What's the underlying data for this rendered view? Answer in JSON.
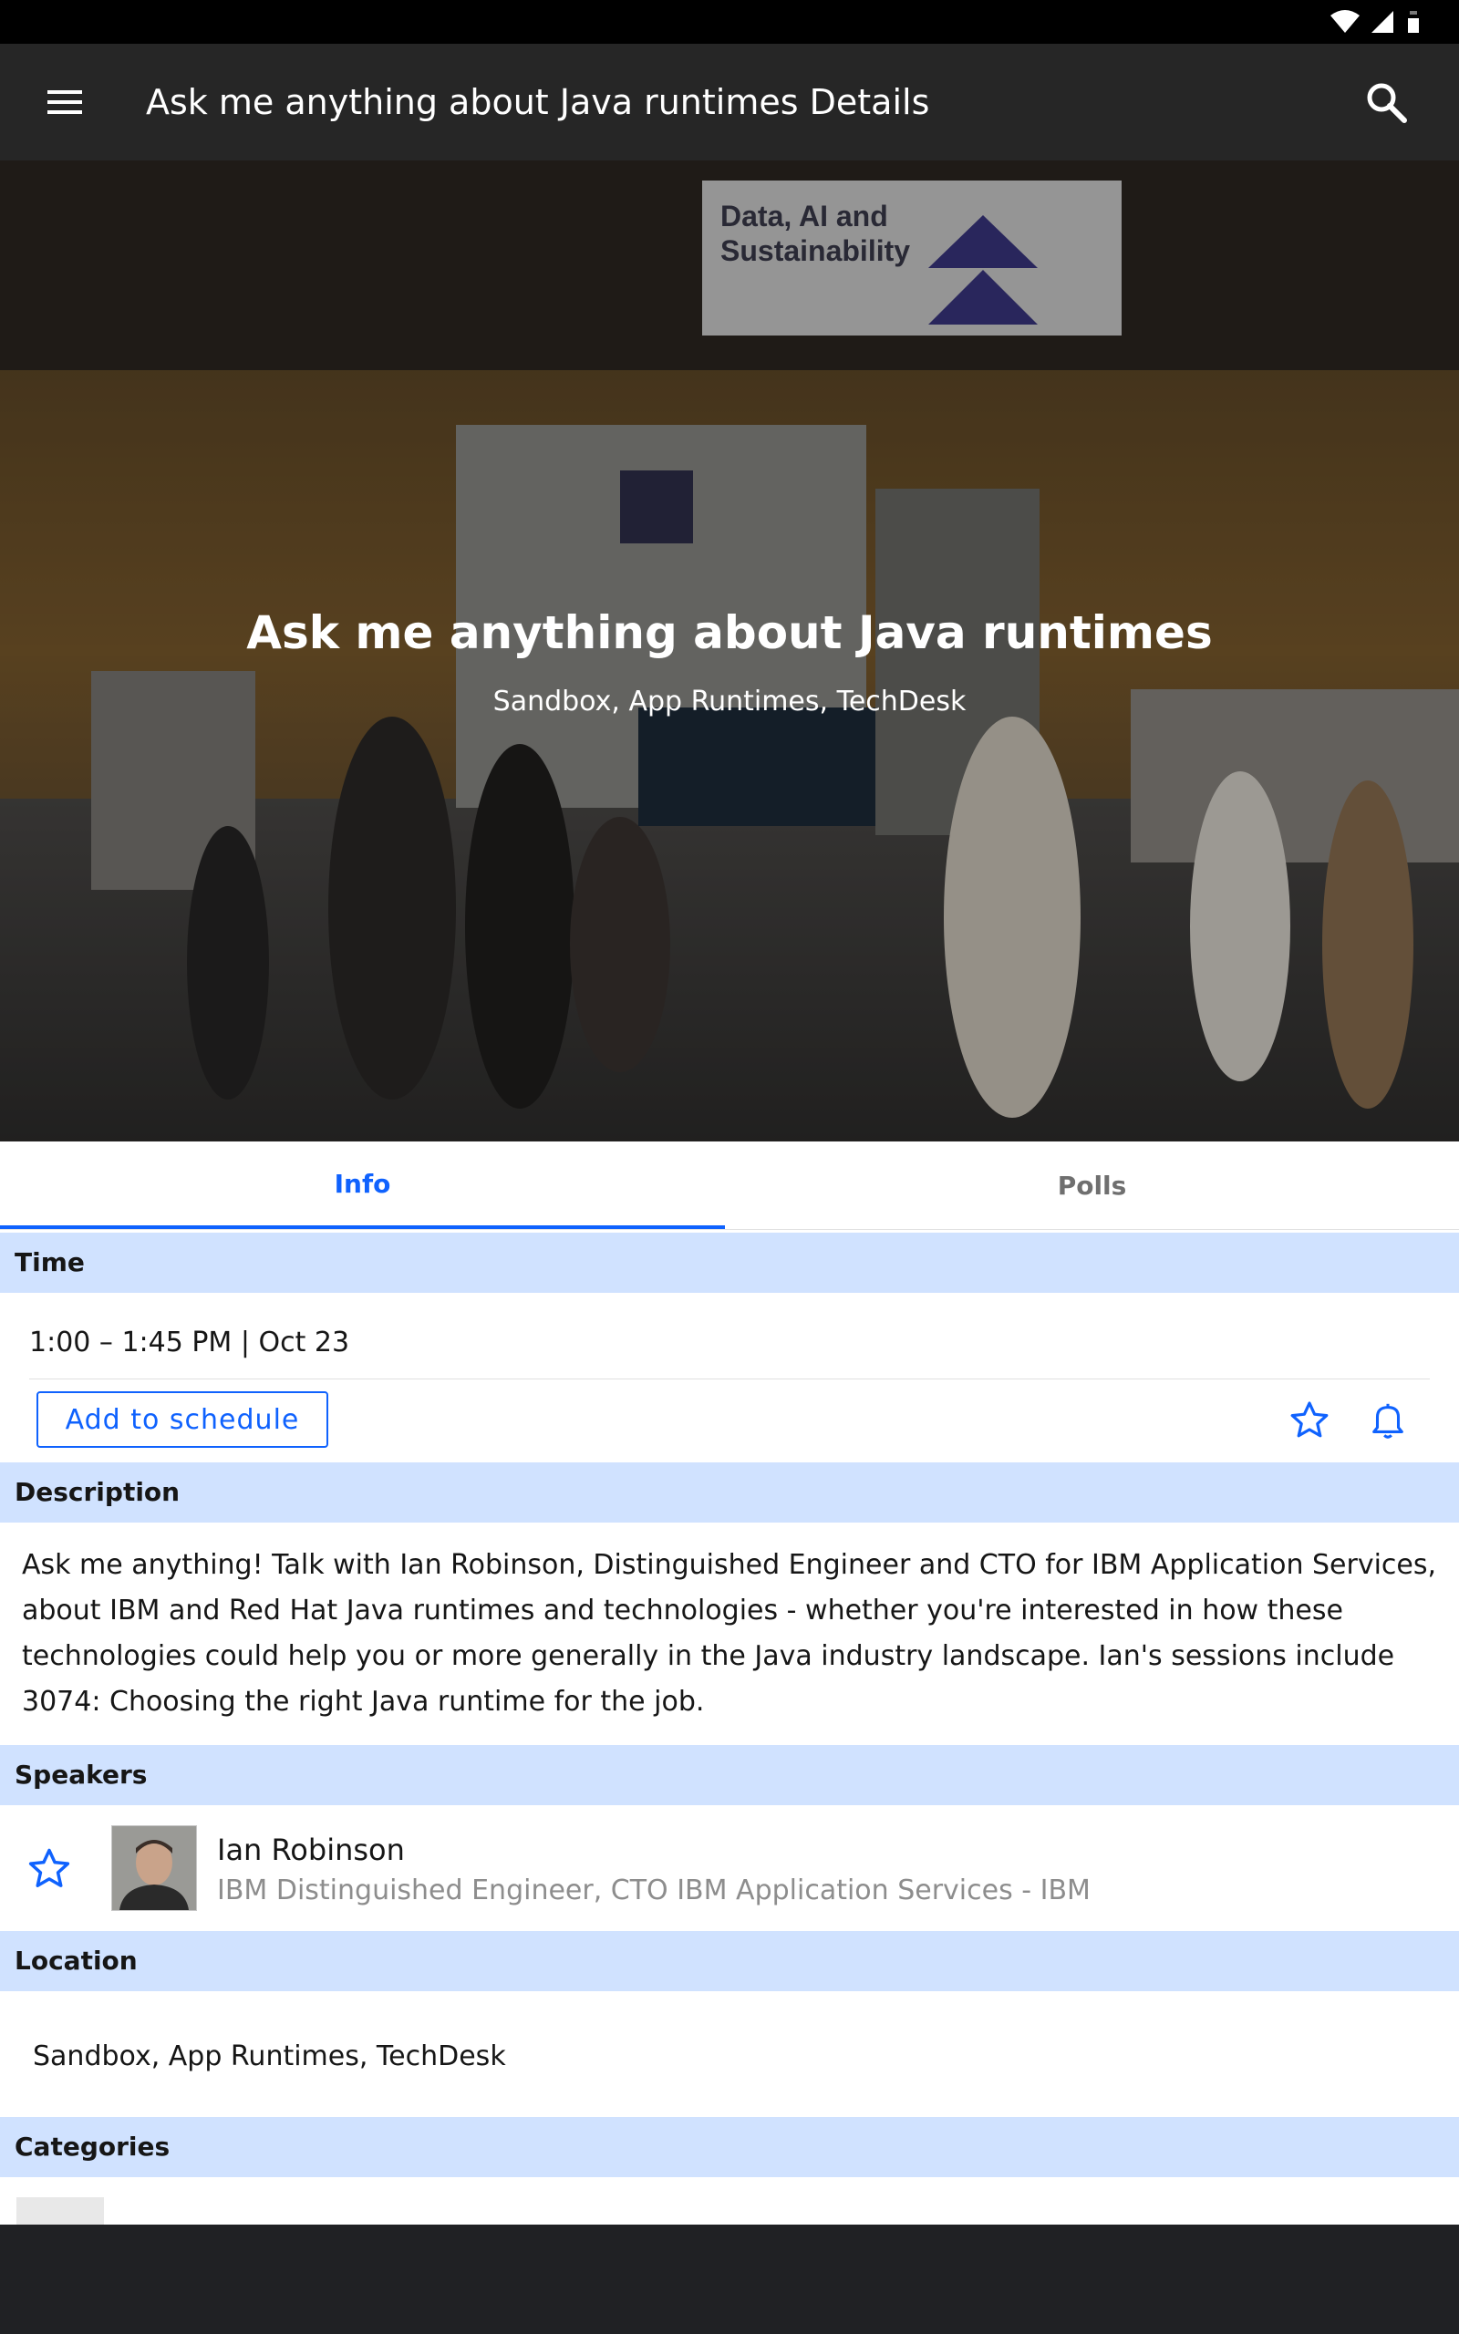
{
  "appbar": {
    "title": "Ask me anything about Java runtimes Details"
  },
  "hero": {
    "title": "Ask me anything about Java runtimes",
    "subtitle": "Sandbox, App Runtimes, TechDesk",
    "sign_text_1": "Data, AI and",
    "sign_text_2": "Sustainability"
  },
  "tabs": {
    "info": "Info",
    "polls": "Polls"
  },
  "sections": {
    "time": "Time",
    "description": "Description",
    "speakers": "Speakers",
    "location": "Location",
    "categories": "Categories"
  },
  "time": {
    "value": "1:00 – 1:45 PM | Oct 23",
    "add_button": "Add to schedule"
  },
  "description": "Ask me anything! Talk with Ian Robinson, Distinguished Engineer and CTO for IBM Application Services, about IBM and Red Hat Java runtimes and technologies - whether you're interested in how these technologies could help you or more generally in the Java industry landscape. Ian's sessions include 3074: Choosing the right Java runtime for the job.",
  "speaker": {
    "name": "Ian Robinson",
    "title": "IBM Distinguished Engineer, CTO IBM Application Services - IBM"
  },
  "location": "Sandbox, App Runtimes, TechDesk",
  "colors": {
    "accent": "#0f62fe",
    "section_bg": "#d0e2ff",
    "appbar": "#262626"
  }
}
